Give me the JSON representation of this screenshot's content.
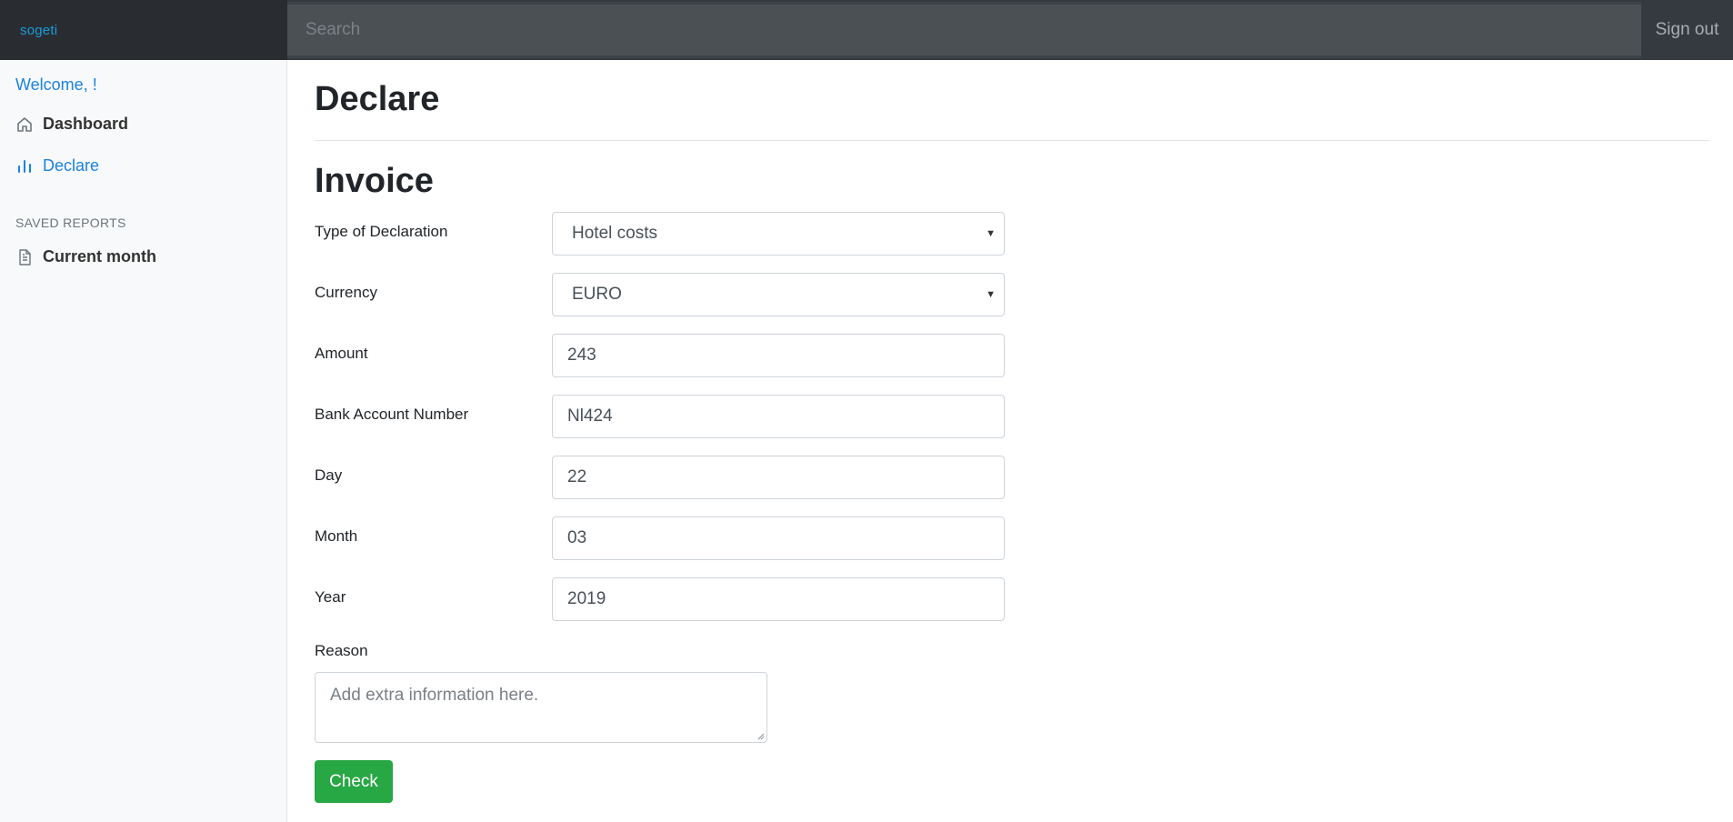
{
  "topbar": {
    "brand": "sogeti",
    "search_placeholder": "Search",
    "signout_label": "Sign out"
  },
  "sidebar": {
    "welcome": "Welcome, !",
    "nav": [
      {
        "label": "Dashboard",
        "icon": "home-icon",
        "active": false
      },
      {
        "label": "Declare",
        "icon": "bar-chart-icon",
        "active": true
      }
    ],
    "saved_reports_heading": "SAVED REPORTS",
    "saved_reports": [
      {
        "label": "Current month",
        "icon": "file-text-icon"
      }
    ]
  },
  "main": {
    "page_title": "Declare",
    "section_title": "Invoice",
    "form": {
      "type_label": "Type of Declaration",
      "type_value": "Hotel costs",
      "currency_label": "Currency",
      "currency_value": "EURO",
      "amount_label": "Amount",
      "amount_value": "243",
      "bank_label": "Bank Account Number",
      "bank_value": "Nl424",
      "day_label": "Day",
      "day_value": "22",
      "month_label": "Month",
      "month_value": "03",
      "year_label": "Year",
      "year_value": "2019",
      "reason_label": "Reason",
      "reason_placeholder": "Add extra information here.",
      "check_label": "Check"
    }
  },
  "colors": {
    "topbar": "#343a40",
    "accent": "#1a82e0",
    "success": "#28a745"
  }
}
